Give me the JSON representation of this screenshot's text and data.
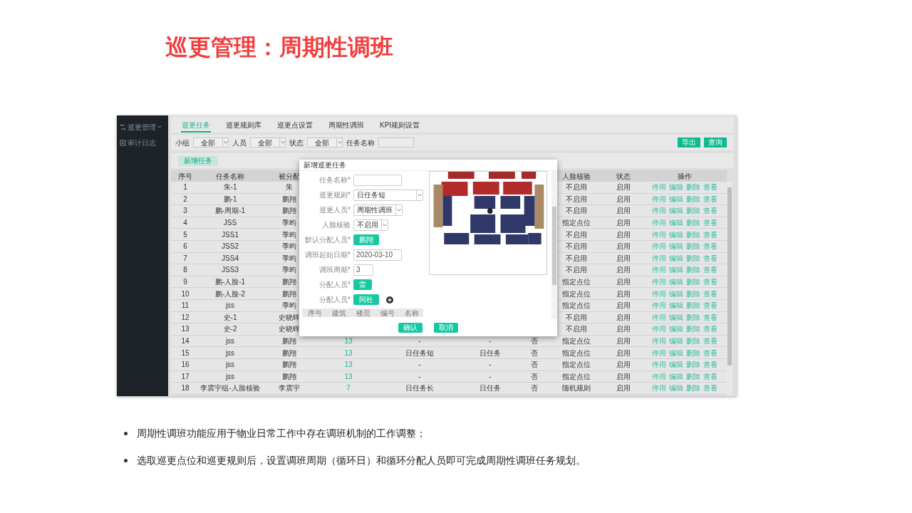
{
  "title": "巡更管理：周期性调班",
  "app": {
    "sidebar": {
      "items": [
        {
          "label": "巡更管理",
          "kind": "menu"
        },
        {
          "label": "审计日志",
          "kind": "link"
        }
      ]
    },
    "tabs": [
      {
        "label": "巡更任务",
        "selected": true
      },
      {
        "label": "巡更规则库",
        "selected": false
      },
      {
        "label": "巡更点设置",
        "selected": false
      },
      {
        "label": "周期性调班",
        "selected": false
      },
      {
        "label": "KPI规则设置",
        "selected": false
      }
    ],
    "filters": [
      {
        "label": "小组",
        "kind": "select",
        "value": "全部"
      },
      {
        "label": "人员",
        "kind": "select",
        "value": "全部"
      },
      {
        "label": "状态",
        "kind": "select",
        "value": "全部"
      },
      {
        "label": "任务名称",
        "kind": "input"
      }
    ],
    "toolbar_buttons": [
      "导出",
      "查询"
    ],
    "new_button": "新增任务",
    "table": {
      "columns": [
        "序号",
        "任务名称",
        "被分配",
        "人脸核验",
        "状态",
        "操作"
      ],
      "rows": [
        {
          "no": "1",
          "name": "朱-1",
          "assignee": "朱",
          "face": "不启用",
          "status": "启用",
          "actions": [
            "停用",
            "编辑",
            "删除",
            "查看"
          ]
        },
        {
          "no": "2",
          "name": "鹏-1",
          "assignee": "鹏翔",
          "face": "不启用",
          "status": "启用",
          "actions": [
            "停用",
            "编辑",
            "删除",
            "查看"
          ]
        },
        {
          "no": "3",
          "name": "鹏-周期-1",
          "assignee": "鹏翔",
          "face": "不启用",
          "status": "启用",
          "actions": [
            "停用",
            "编辑",
            "删除",
            "查看"
          ]
        },
        {
          "no": "4",
          "name": "JSS",
          "assignee": "季昀",
          "face": "指定点位",
          "status": "启用",
          "actions": [
            "停用",
            "编辑",
            "删除",
            "查看"
          ]
        },
        {
          "no": "5",
          "name": "JSS1",
          "assignee": "季昀",
          "face": "不启用",
          "status": "启用",
          "actions": [
            "停用",
            "编辑",
            "删除",
            "查看"
          ]
        },
        {
          "no": "6",
          "name": "JSS2",
          "assignee": "季昀",
          "face": "不启用",
          "status": "启用",
          "actions": [
            "停用",
            "编辑",
            "删除",
            "查看"
          ]
        },
        {
          "no": "7",
          "name": "JSS4",
          "assignee": "季昀",
          "face": "不启用",
          "status": "启用",
          "actions": [
            "停用",
            "编辑",
            "删除",
            "查看"
          ]
        },
        {
          "no": "8",
          "name": "JSS3",
          "assignee": "季昀",
          "face": "不启用",
          "status": "启用",
          "actions": [
            "停用",
            "编辑",
            "删除",
            "查看"
          ]
        },
        {
          "no": "9",
          "name": "鹏-人脸-1",
          "assignee": "鹏翔",
          "face": "指定点位",
          "status": "启用",
          "actions": [
            "停用",
            "编辑",
            "删除",
            "查看"
          ]
        },
        {
          "no": "10",
          "name": "鹏-人脸-2",
          "assignee": "鹏翔",
          "face": "指定点位",
          "status": "启用",
          "actions": [
            "停用",
            "编辑",
            "删除",
            "查看"
          ]
        },
        {
          "no": "11",
          "name": "jss",
          "assignee": "季昀",
          "face": "指定点位",
          "status": "启用",
          "actions": [
            "停用",
            "编辑",
            "删除",
            "查看"
          ]
        },
        {
          "no": "12",
          "name": "史-1",
          "assignee": "史晓晖",
          "face": "不启用",
          "status": "启用",
          "actions": [
            "停用",
            "编辑",
            "删除",
            "查看"
          ]
        },
        {
          "no": "13",
          "name": "史-2",
          "assignee": "史晓晖",
          "face": "不启用",
          "status": "启用",
          "actions": [
            "停用",
            "编辑",
            "删除",
            "查看"
          ]
        },
        {
          "no": "14",
          "name": "jss",
          "assignee": "鹏翔",
          "column_4": "13",
          "column_5": "-",
          "column_6": "-",
          "column_7": "否",
          "face": "指定点位",
          "status": "启用",
          "actions": [
            "停用",
            "编辑",
            "删除",
            "查看"
          ]
        },
        {
          "no": "15",
          "name": "jss",
          "assignee": "鹏翔",
          "column_4": "13",
          "column_5": "日任务短",
          "column_6": "日任务",
          "column_7": "否",
          "face": "指定点位",
          "status": "启用",
          "actions": [
            "停用",
            "编辑",
            "删除",
            "查看"
          ]
        },
        {
          "no": "16",
          "name": "jss",
          "assignee": "鹏翔",
          "column_4": "13",
          "column_5": "-",
          "column_6": "-",
          "column_7": "否",
          "face": "指定点位",
          "status": "启用",
          "actions": [
            "停用",
            "编辑",
            "删除",
            "查看"
          ]
        },
        {
          "no": "17",
          "name": "jss",
          "assignee": "鹏翔",
          "column_4": "13",
          "column_5": "-",
          "column_6": "-",
          "column_7": "否",
          "face": "指定点位",
          "status": "启用",
          "actions": [
            "停用",
            "编辑",
            "删除",
            "查看"
          ]
        },
        {
          "no": "18",
          "name": "李震宇组-人脸核验",
          "assignee": "李震宇",
          "column_4": "7",
          "column_5": "日任务长",
          "column_6": "日任务",
          "column_7": "否",
          "face": "随机规则",
          "status": "启用",
          "actions": [
            "停用",
            "编辑",
            "删除",
            "查看"
          ]
        }
      ]
    },
    "dialog": {
      "title": "新增巡更任务",
      "fields": [
        {
          "label": "任务名称*",
          "kind": "input",
          "add": false
        },
        {
          "label": "巡更规则*",
          "kind": "select",
          "value": "日任务短",
          "add": false
        },
        {
          "label": "巡更人员*",
          "kind": "select",
          "value": "周期性调班",
          "add": false
        },
        {
          "label": "人脸核验",
          "kind": "select",
          "value": "不启用",
          "add": false
        },
        {
          "label": "默认分配人员*",
          "kind": "chip",
          "value": "鹏翔",
          "add": false
        },
        {
          "label": "调班起始日期*",
          "kind": "input",
          "value": "2020-03-10",
          "add": false
        },
        {
          "label": "调班周期*",
          "kind": "input",
          "value": "3",
          "add": false
        },
        {
          "label": "分配人员*",
          "kind": "chip",
          "value": "雷",
          "add": false
        },
        {
          "label": "分配人员*",
          "kind": "chip",
          "value": "阿杜",
          "add": true
        }
      ],
      "points_columns": [
        "序号",
        "建筑",
        "楼层",
        "编号",
        "名称"
      ],
      "map": {
        "kind": "picture"
      },
      "buttons": [
        "确认",
        "取消"
      ]
    }
  },
  "bullets": [
    "周期性调班功能应用于物业日常工作中存在调班机制的工作调整；",
    "选取巡更点位和巡更规则后，设置调班周期（循环日）和循环分配人员即可完成周期性调班任务规划。"
  ]
}
